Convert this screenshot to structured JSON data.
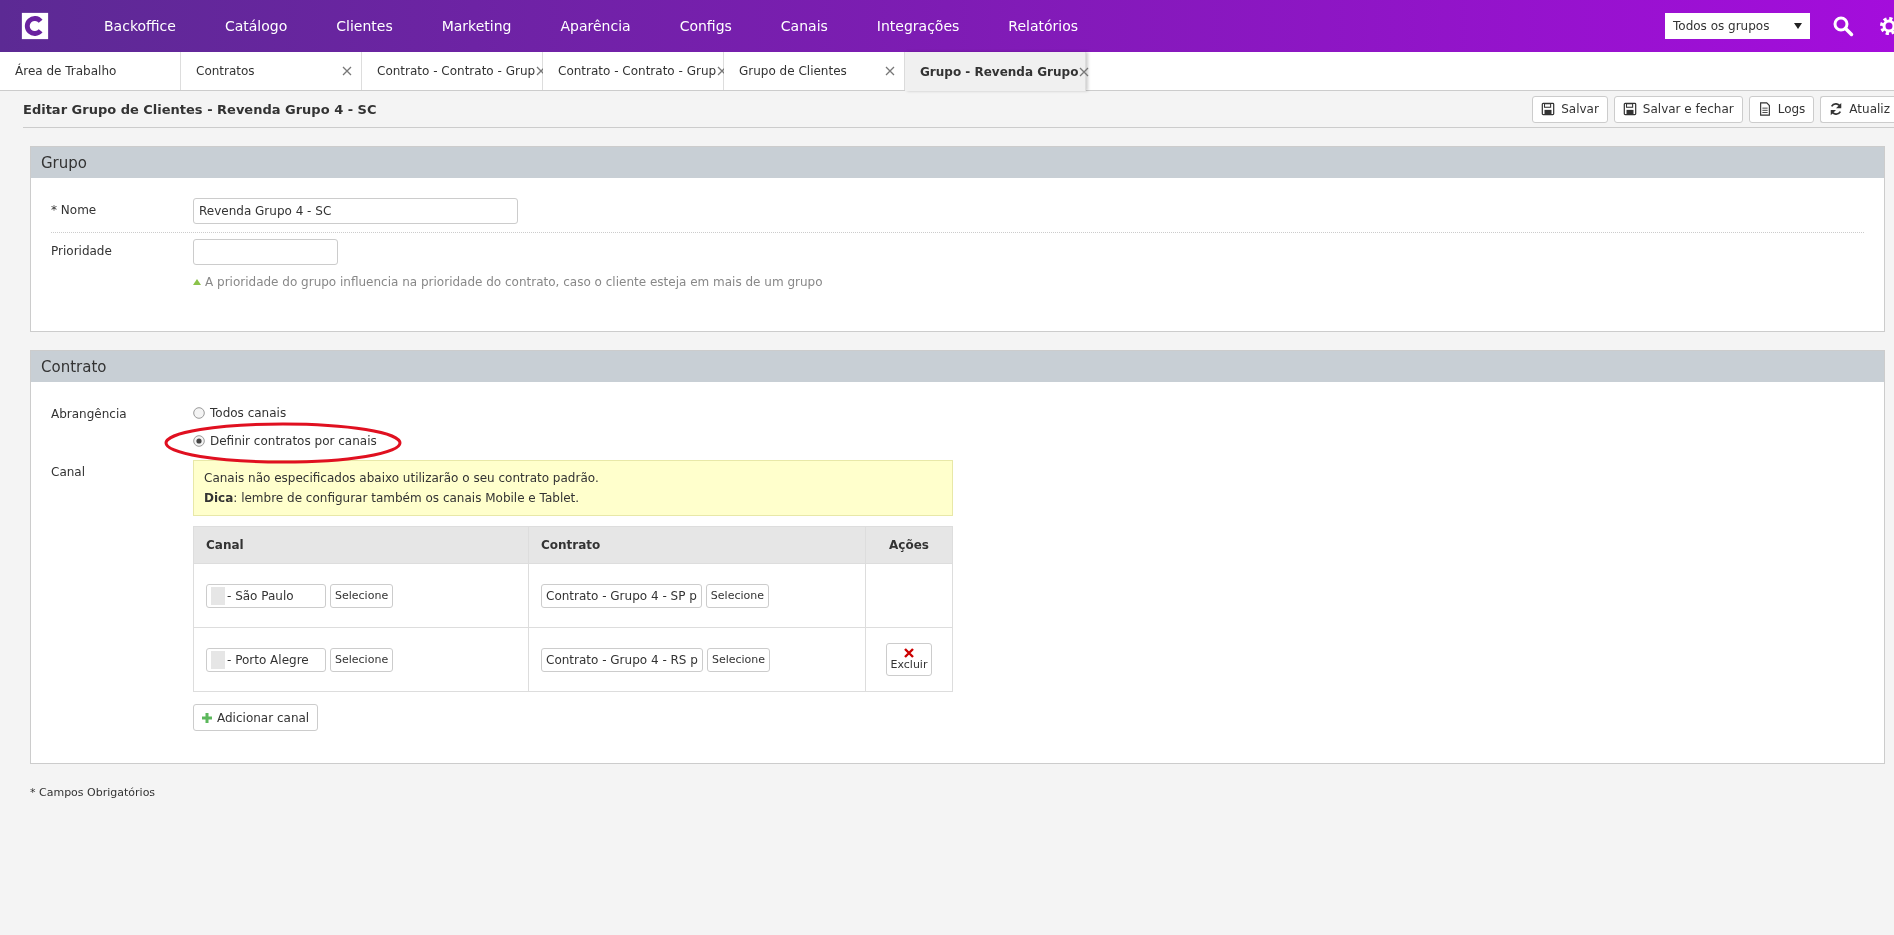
{
  "nav": {
    "items": [
      "Backoffice",
      "Catálogo",
      "Clientes",
      "Marketing",
      "Aparência",
      "Configs",
      "Canais",
      "Integrações",
      "Relatórios"
    ],
    "group_select": "Todos os grupos"
  },
  "tabs": [
    {
      "label": "Área de Trabalho",
      "selected": false,
      "closable": false
    },
    {
      "label": "Contratos",
      "selected": false,
      "closable": true
    },
    {
      "label": "Contrato - Contrato - Grup",
      "selected": false,
      "closable": true
    },
    {
      "label": "Contrato - Contrato - Grup",
      "selected": false,
      "closable": true
    },
    {
      "label": "Grupo de Clientes",
      "selected": false,
      "closable": true
    },
    {
      "label": "Grupo - Revenda Grupo",
      "selected": true,
      "closable": true
    }
  ],
  "page_title": "Editar Grupo de Clientes - Revenda Grupo 4 - SC",
  "toolbar": [
    {
      "kind": "save",
      "label": "Salvar"
    },
    {
      "kind": "save",
      "label": "Salvar e fechar"
    },
    {
      "kind": "doc",
      "label": "Logs"
    },
    {
      "kind": "refresh",
      "label": "Atualiz"
    }
  ],
  "grupo": {
    "title": "Grupo",
    "nome_label": "* Nome",
    "nome_value": "Revenda Grupo 4 - SC",
    "prioridade_label": "Prioridade",
    "hint": "A prioridade do grupo influencia na prioridade do contrato, caso o cliente esteja em mais de um grupo"
  },
  "contrato": {
    "title": "Contrato",
    "abrangencia_label": "Abrangência",
    "options": [
      {
        "label": "Todos canais",
        "selected": false,
        "circled": false
      },
      {
        "label": "Definir contratos por canais",
        "selected": true,
        "circled": true
      }
    ],
    "canal_label": "Canal",
    "notice": "Canais não especificados abaixo utilizarão o seu contrato padrão.",
    "tip": "**Dica**: lembre de configurar também os canais Mobile e Tablet.",
    "columns": [
      "Canal",
      "Contrato",
      "Ações"
    ],
    "rows": [
      {
        "canal": "- São Paulo",
        "canal_button": "Selecione",
        "contrato": "Contrato - Grupo 4 - SP p",
        "contrato_button": "Selecione",
        "deletable": false
      },
      {
        "canal": "- Porto Alegre",
        "canal_button": "Selecione",
        "contrato": "Contrato - Grupo 4 - RS p",
        "contrato_button": "Selecione",
        "deletable": true,
        "delete_label": "Excluir"
      }
    ],
    "add_button": "Adicionar canal"
  },
  "footnote": "* Campos Obrigatórios"
}
